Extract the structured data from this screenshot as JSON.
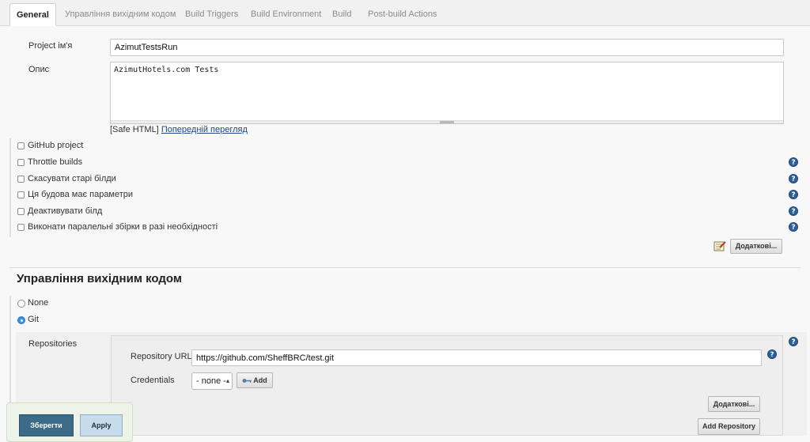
{
  "tabs": [
    {
      "label": "General"
    },
    {
      "label": "Управління вихідним кодом"
    },
    {
      "label": "Build Triggers"
    },
    {
      "label": "Build Environment"
    },
    {
      "label": "Build"
    },
    {
      "label": "Post-build Actions"
    }
  ],
  "active_tab": "General",
  "general": {
    "project_name_label": "Project ім'я",
    "project_name_value": "AzimutTestsRun",
    "description_label": "Опис",
    "description_value": "AzimutHotels.com Tests",
    "safe_html_label": "[Safe HTML]",
    "preview_link": "Попередній перегляд",
    "options": [
      {
        "label": "GitHub project",
        "checked": false,
        "help": false
      },
      {
        "label": "Throttle builds",
        "checked": false,
        "help": true
      },
      {
        "label": "Скасувати старі білди",
        "checked": false,
        "help": true
      },
      {
        "label": "Ця будова має параметри",
        "checked": false,
        "help": true
      },
      {
        "label": "Деактивувати білд",
        "checked": false,
        "help": true
      },
      {
        "label": "Виконати паралельні збірки в разі необхідності",
        "checked": false,
        "help": true
      }
    ],
    "advanced_button": "Додаткові..."
  },
  "scm": {
    "title": "Управління вихідним кодом",
    "options": [
      {
        "label": "None",
        "selected": false
      },
      {
        "label": "Git",
        "selected": true
      }
    ],
    "repositories_label": "Repositories",
    "repository_url_label": "Repository URL",
    "repository_url_value": "https://github.com/SheffBRC/test.git",
    "credentials_label": "Credentials",
    "credentials_value": "- none -",
    "add_button": "Add",
    "advanced_button": "Додаткові...",
    "add_repository_button": "Add Repository"
  },
  "footer": {
    "save_button": "Зберегти",
    "apply_button": "Apply"
  },
  "help_glyph": "?",
  "colors": {
    "save_button_bg": "#3c6a89",
    "apply_button_bg": "#c8dbea",
    "link": "#204a87",
    "help_icon": "#2e5f99"
  }
}
